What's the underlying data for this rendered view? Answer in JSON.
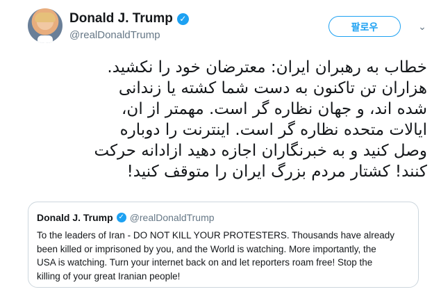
{
  "author": {
    "display_name": "Donald J. Trump",
    "handle": "@realDonaldTrump",
    "verified_icon": "verified-badge-icon"
  },
  "actions": {
    "follow_label": "팔로우",
    "menu_icon": "chevron-down-icon"
  },
  "tweet": {
    "lines": [
      "خطاب به رهبران ایران: معترضان خود را نکشید.",
      "هزاران تن تاکنون به دست شما کشته یا زندانی",
      "شده اند، و جهان نظاره گر است. مهمتر از ان،",
      "ایالات متحده نظاره گر است. اینترنت را دوباره",
      "وصل کنید و به خبرنگاران اجازه دهید ازادانه حرکت",
      "کنند! کشتار مردم بزرگ ایران را متوقف کنید!"
    ]
  },
  "quoted": {
    "display_name": "Donald J. Trump",
    "handle": "@realDonaldTrump",
    "lines": [
      "To the leaders of Iran - DO NOT KILL YOUR PROTESTERS. Thousands have already",
      "been killed or imprisoned by you, and the World is watching. More importantly, the",
      "USA is watching. Turn your internet back on and let reporters roam free! Stop the",
      "killing of your great Iranian people!"
    ]
  },
  "colors": {
    "accent": "#1da1f2",
    "text": "#14171a",
    "secondary": "#657786",
    "border": "#ccd6dd"
  }
}
